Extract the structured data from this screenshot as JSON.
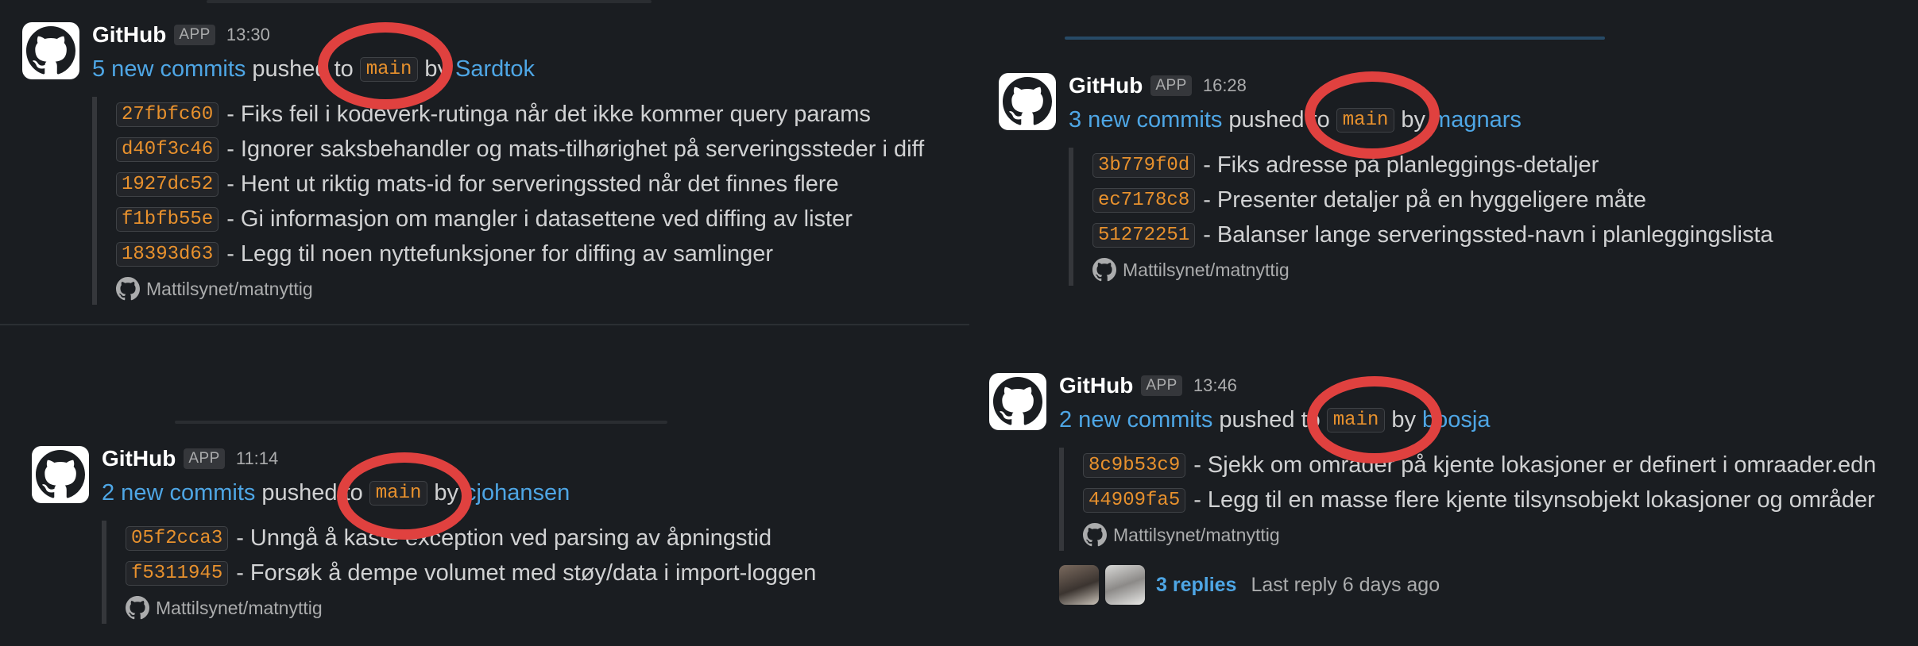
{
  "colors": {
    "background": "#1a1d21",
    "link": "#4ea6e5",
    "code": "#e8912d",
    "highlight_ring": "#e0413f"
  },
  "messages": [
    {
      "sender": "GitHub",
      "badge": "APP",
      "time": "13:30",
      "summary_link": "5 new commits",
      "pushed_text": "pushed to",
      "branch": "main",
      "by_text": "by",
      "author": "Sardtok",
      "commits": [
        {
          "sha": "27fbfc60",
          "message": "- Fiks feil i kodeverk-rutinga når det ikke kommer query params"
        },
        {
          "sha": "d40f3c46",
          "message": "- Ignorer saksbehandler og mats-tilhørighet på serveringssteder i diff"
        },
        {
          "sha": "1927dc52",
          "message": "- Hent ut riktig mats-id for serveringssted når det finnes flere"
        },
        {
          "sha": "f1bfb55e",
          "message": "- Gi informasjon om mangler i datasettene ved diffing av lister"
        },
        {
          "sha": "18393d63",
          "message": "- Legg til noen nyttefunksjoner for diffing av samlinger"
        }
      ],
      "repo": "Mattilsynet/matnyttig"
    },
    {
      "sender": "GitHub",
      "badge": "APP",
      "time": "11:14",
      "summary_link": "2 new commits",
      "pushed_text": "pushed to",
      "branch": "main",
      "by_text": "by",
      "author": "cjohansen",
      "commits": [
        {
          "sha": "05f2cca3",
          "message": "- Unngå å kaste exception ved parsing av åpningstid"
        },
        {
          "sha": "f5311945",
          "message": "- Forsøk å dempe volumet med støy/data i import-loggen"
        }
      ],
      "repo": "Mattilsynet/matnyttig"
    },
    {
      "sender": "GitHub",
      "badge": "APP",
      "time": "16:28",
      "summary_link": "3 new commits",
      "pushed_text": "pushed to",
      "branch": "main",
      "by_text": "by",
      "author": "magnars",
      "commits": [
        {
          "sha": "3b779f0d",
          "message": "- Fiks adresse på planleggings-detaljer"
        },
        {
          "sha": "ec7178c8",
          "message": "- Presenter detaljer på en hyggeligere måte"
        },
        {
          "sha": "51272251",
          "message": "- Balanser lange serveringssted-navn i planleggingslista"
        }
      ],
      "repo": "Mattilsynet/matnyttig"
    },
    {
      "sender": "GitHub",
      "badge": "APP",
      "time": "13:46",
      "summary_link": "2 new commits",
      "pushed_text": "pushed to",
      "branch": "main",
      "by_text": "by",
      "author": "boosja",
      "commits": [
        {
          "sha": "8c9b53c9",
          "message": "- Sjekk om områder på kjente lokasjoner er definert i omraader.edn"
        },
        {
          "sha": "44909fa5",
          "message": "- Legg til en masse flere kjente tilsynsobjekt lokasjoner og områder"
        }
      ],
      "repo": "Mattilsynet/matnyttig",
      "replies": {
        "count": "3 replies",
        "last": "Last reply 6 days ago"
      }
    }
  ]
}
